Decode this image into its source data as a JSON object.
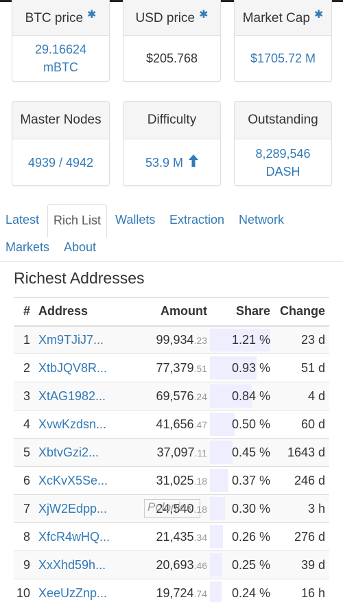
{
  "stats": [
    {
      "title": "BTC price",
      "star": true,
      "value_lines": [
        "29.16624",
        "mBTC"
      ],
      "color": "blue"
    },
    {
      "title": "USD price",
      "star": true,
      "value_lines": [
        "$205.768"
      ],
      "color": "dark"
    },
    {
      "title": "Market Cap",
      "star": true,
      "value_lines": [
        "$1705.72 M"
      ],
      "color": "blue"
    },
    {
      "title": "Master Nodes",
      "star": false,
      "value_lines": [
        "4939 / 4942"
      ],
      "color": "blue"
    },
    {
      "title": "Difficulty",
      "star": false,
      "value_lines": [
        "53.9 M"
      ],
      "color": "blue",
      "trend_icon": "arrow-up-icon"
    },
    {
      "title": "Outstanding",
      "star": false,
      "value_lines": [
        "8,289,546",
        "DASH"
      ],
      "color": "blue"
    }
  ],
  "icons": {
    "star": "✱",
    "arrow_up": "🠉"
  },
  "nav": {
    "tabs": [
      "Latest",
      "Rich List",
      "Wallets",
      "Extraction",
      "Network",
      "Markets",
      "About"
    ],
    "active": "Rich List"
  },
  "section_title": "Richest Addresses",
  "table": {
    "headers": {
      "rank": "#",
      "address": "Address",
      "amount": "Amount",
      "share": "Share",
      "change": "Change"
    },
    "rows": [
      {
        "rank": "1",
        "address": "Xm9TJiJ7...",
        "amount_int": "99,934",
        "amount_dec": ".23",
        "share": "1.21 %",
        "share_pct": 1.21,
        "change": "23 d"
      },
      {
        "rank": "2",
        "address": "XtbJQV8R...",
        "amount_int": "77,379",
        "amount_dec": ".51",
        "share": "0.93 %",
        "share_pct": 0.93,
        "change": "51 d"
      },
      {
        "rank": "3",
        "address": "XtAG1982...",
        "amount_int": "69,576",
        "amount_dec": ".24",
        "share": "0.84 %",
        "share_pct": 0.84,
        "change": "4 d"
      },
      {
        "rank": "4",
        "address": "XvwKzdsn...",
        "amount_int": "41,656",
        "amount_dec": ".47",
        "share": "0.50 %",
        "share_pct": 0.5,
        "change": "60 d"
      },
      {
        "rank": "5",
        "address": "XbtvGzi2...",
        "amount_int": "37,097",
        "amount_dec": ".11",
        "share": "0.45 %",
        "share_pct": 0.45,
        "change": "1643 d"
      },
      {
        "rank": "6",
        "address": "XcKvX5Se...",
        "amount_int": "31,025",
        "amount_dec": ".18",
        "share": "0.37 %",
        "share_pct": 0.37,
        "change": "246 d"
      },
      {
        "rank": "7",
        "address": "XjW2Edpp...",
        "label": "Poloniex",
        "amount_int": "24,540",
        "amount_dec": ".18",
        "share": "0.30 %",
        "share_pct": 0.3,
        "change": "3 h"
      },
      {
        "rank": "8",
        "address": "XfcR4wHQ...",
        "amount_int": "21,435",
        "amount_dec": ".34",
        "share": "0.26 %",
        "share_pct": 0.26,
        "change": "276 d"
      },
      {
        "rank": "9",
        "address": "XxXhd59h...",
        "amount_int": "20,693",
        "amount_dec": ".46",
        "share": "0.25 %",
        "share_pct": 0.25,
        "change": "39 d"
      },
      {
        "rank": "10",
        "address": "XeeUzZnp...",
        "amount_int": "19,724",
        "amount_dec": ".74",
        "share": "0.24 %",
        "share_pct": 0.24,
        "change": "16 h"
      }
    ]
  },
  "colors": {
    "link": "#337ab7",
    "share_bar": "#eeeeff",
    "panel_header": "#f5f5f5"
  }
}
